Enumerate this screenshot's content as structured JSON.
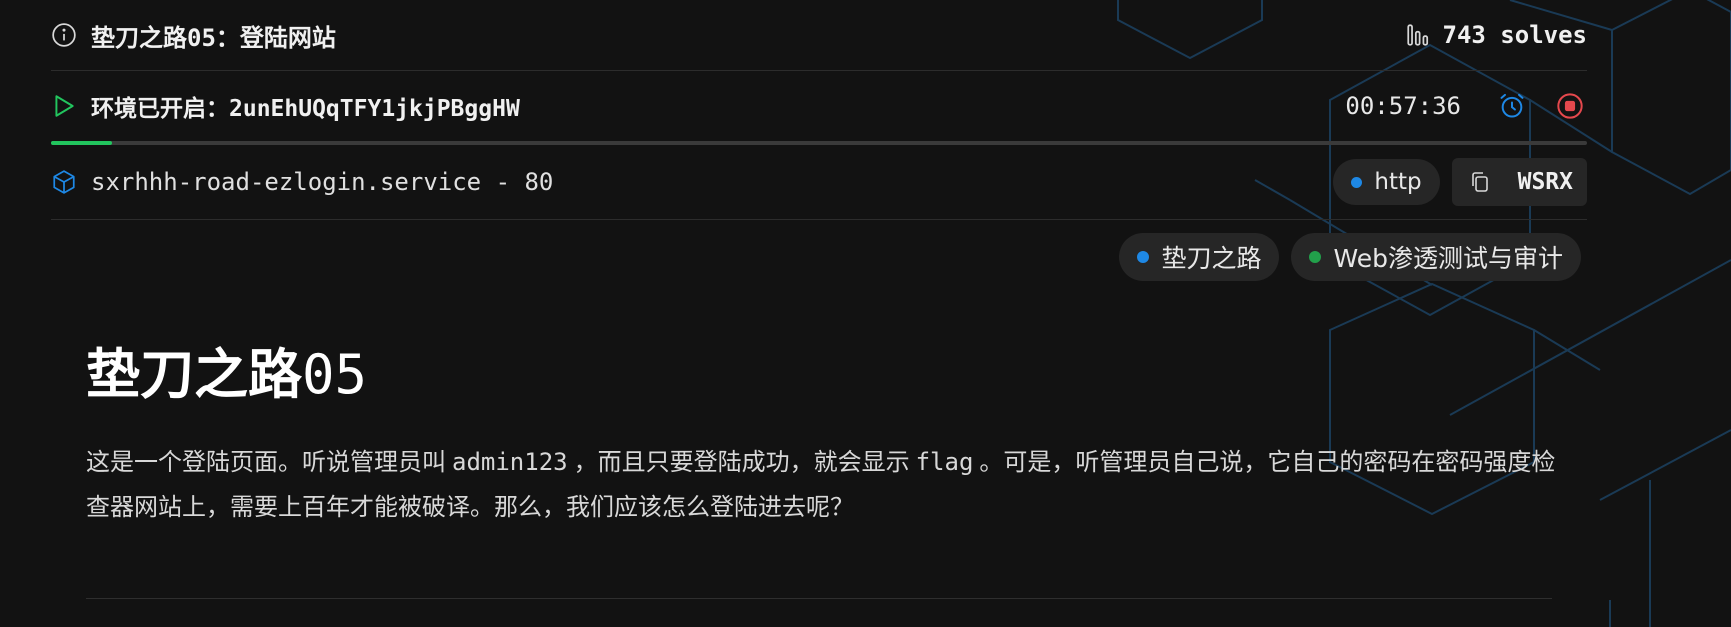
{
  "challenge": {
    "title": "垫刀之路05：登陆网站",
    "solves": "743 solves"
  },
  "environment": {
    "status_label": "环境已开启：",
    "instance_id": "2unEhUQqTFY1jkjPBggHW",
    "timer": "00:57:36",
    "progress_percent": 4
  },
  "service": {
    "name": "sxrhhh-road-ezlogin.service - 80",
    "protocol": "http",
    "copy_label": "WSRX"
  },
  "tags": [
    {
      "label": "垫刀之路",
      "color": "#1e88e5"
    },
    {
      "label": "Web渗透测试与审计",
      "color": "#22a04b"
    }
  ],
  "heading": {
    "cjk": "垫刀之路",
    "num": "05"
  },
  "description": {
    "p1": "这是一个登陆页面。听说管理员叫",
    "code1": "admin123",
    "p2": "，而且只要登陆成功，就会显示",
    "code2": "flag",
    "p3": "。可是，听管理员自己说，它自己的密码在密码强度检查器网站上，需要上百年才能被破译。那么，我们应该怎么登陆进去呢？"
  },
  "colors": {
    "background": "#121212",
    "accent_blue": "#1e88e5",
    "accent_green": "#22c55e",
    "stop_red": "#e5484d",
    "chip_bg": "#262626"
  },
  "icons": {
    "info": "info-circle-icon",
    "solves": "bar-chart-icon",
    "play": "play-icon",
    "alarm": "alarm-clock-icon",
    "stop": "stop-circle-icon",
    "service": "cube-icon",
    "copy": "copy-icon"
  }
}
